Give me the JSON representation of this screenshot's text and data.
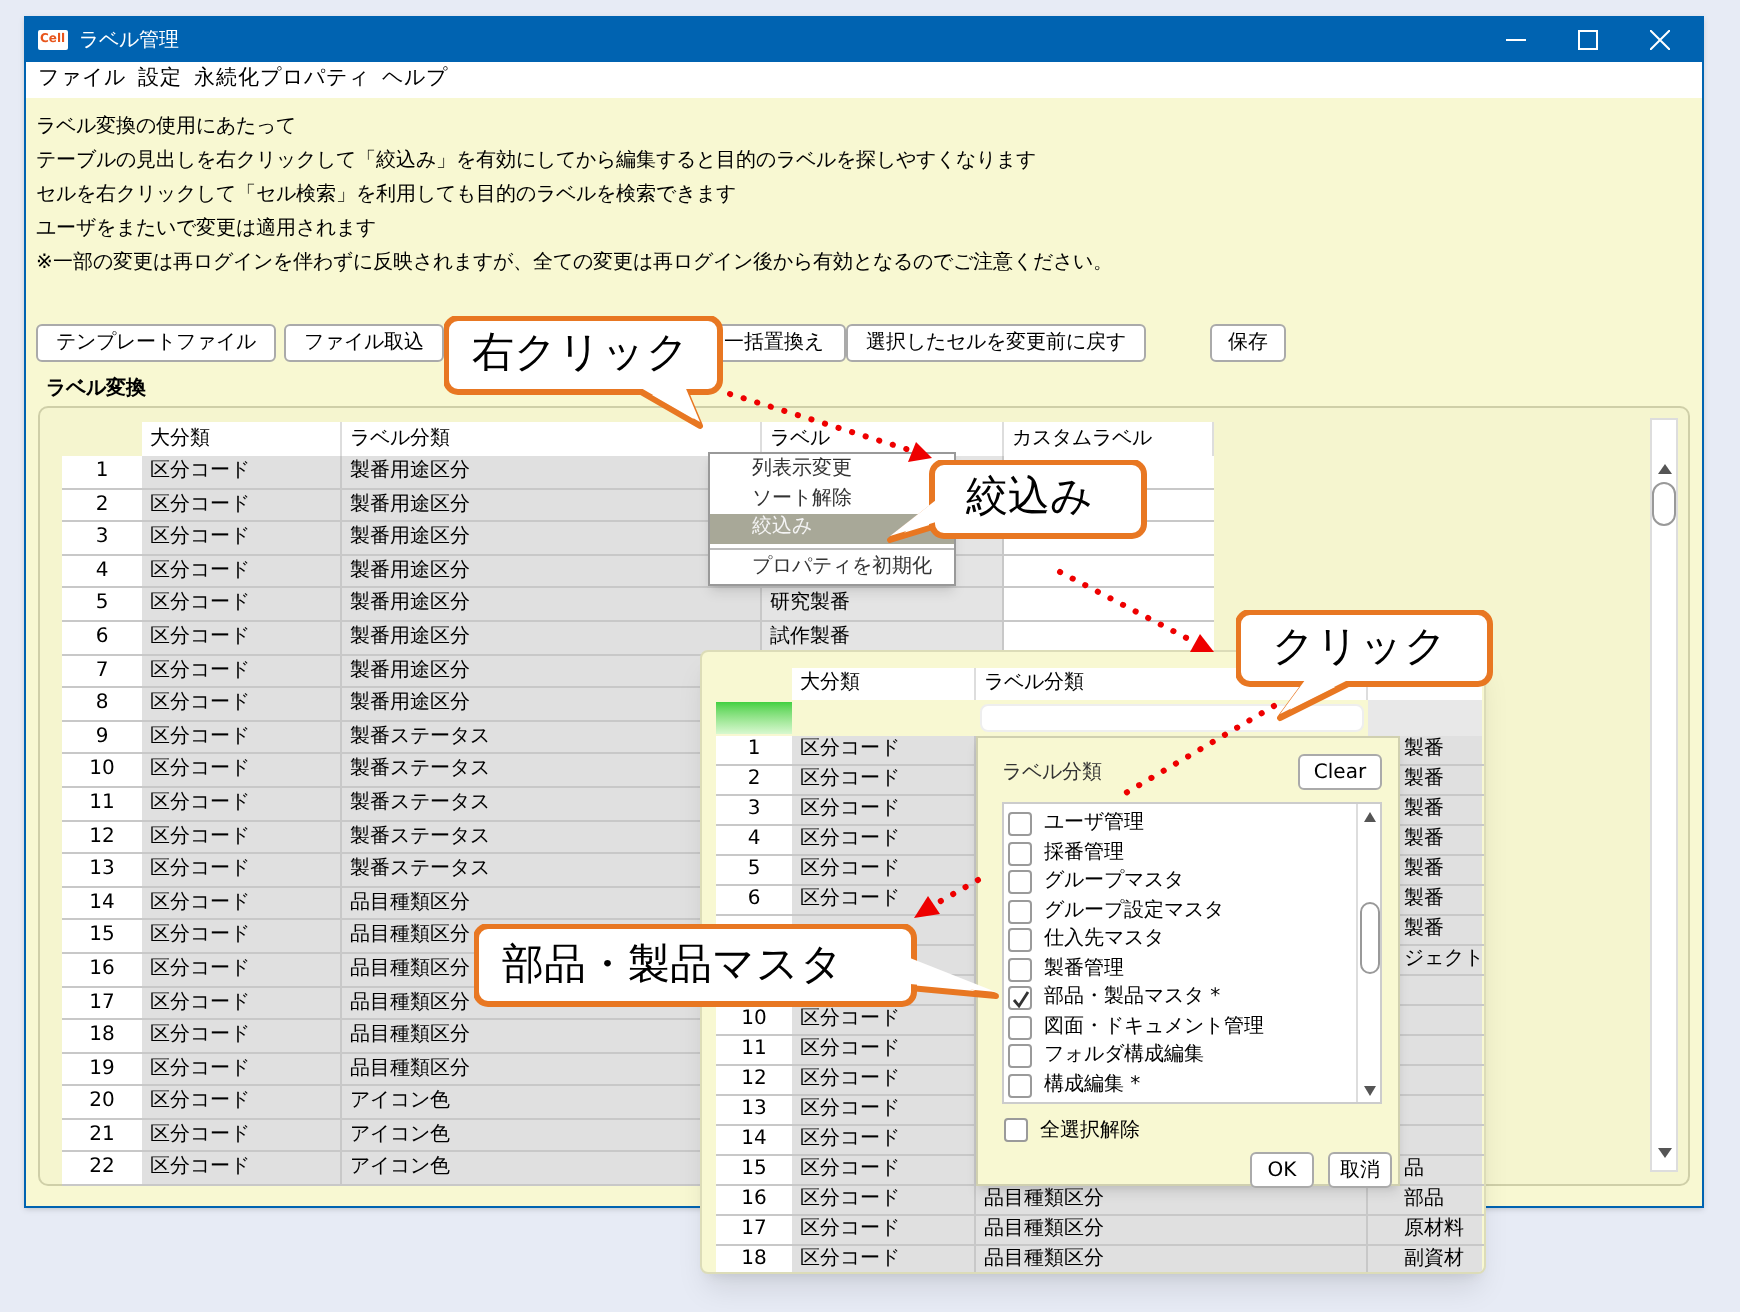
{
  "window": {
    "title": "ラベル管理",
    "badge": "Cell"
  },
  "menu": [
    "ファイル",
    "設定",
    "永続化プロパティ",
    "ヘルプ"
  ],
  "notes": [
    "ラベル変換の使用にあたって",
    "テーブルの見出しを右クリックして「絞込み」を有効にしてから編集すると目的のラベルを探しやすくなります",
    "セルを右クリックして「セル検索」を利用しても目的のラベルを検索できます",
    "ユーザをまたいで変更は適用されます",
    "※一部の変更は再ログインを伴わずに反映されますが、全ての変更は再ログイン後から有効となるのでご注意ください。"
  ],
  "toolbar": [
    "テンプレートファイル",
    "ファイル取込",
    "一括置換え",
    "選択したセルを変更前に戻す",
    "保存"
  ],
  "section_title": "ラベル変換",
  "table": {
    "columns": [
      "大分類",
      "ラベル分類",
      "ラベル",
      "カスタムラベル"
    ],
    "rows": [
      {
        "number": "1",
        "category": "区分コード",
        "label_class": "製番用途区分"
      },
      {
        "number": "2",
        "category": "区分コード",
        "label_class": "製番用途区分"
      },
      {
        "number": "3",
        "category": "区分コード",
        "label_class": "製番用途区分"
      },
      {
        "number": "4",
        "category": "区分コード",
        "label_class": "製番用途区分"
      },
      {
        "number": "5",
        "category": "区分コード",
        "label_class": "製番用途区分",
        "label": "研究製番"
      },
      {
        "number": "6",
        "category": "区分コード",
        "label_class": "製番用途区分",
        "label": "試作製番"
      },
      {
        "number": "7",
        "category": "区分コード",
        "label_class": "製番用途区分"
      },
      {
        "number": "8",
        "category": "区分コード",
        "label_class": "製番用途区分"
      },
      {
        "number": "9",
        "category": "区分コード",
        "label_class": "製番ステータス"
      },
      {
        "number": "10",
        "category": "区分コード",
        "label_class": "製番ステータス"
      },
      {
        "number": "11",
        "category": "区分コード",
        "label_class": "製番ステータス"
      },
      {
        "number": "12",
        "category": "区分コード",
        "label_class": "製番ステータス"
      },
      {
        "number": "13",
        "category": "区分コード",
        "label_class": "製番ステータス"
      },
      {
        "number": "14",
        "category": "区分コード",
        "label_class": "品目種類区分"
      },
      {
        "number": "15",
        "category": "区分コード",
        "label_class": "品目種類区分"
      },
      {
        "number": "16",
        "category": "区分コード",
        "label_class": "品目種類区分"
      },
      {
        "number": "17",
        "category": "区分コード",
        "label_class": "品目種類区分"
      },
      {
        "number": "18",
        "category": "区分コード",
        "label_class": "品目種類区分"
      },
      {
        "number": "19",
        "category": "区分コード",
        "label_class": "品目種類区分"
      },
      {
        "number": "20",
        "category": "区分コード",
        "label_class": "アイコン色"
      },
      {
        "number": "21",
        "category": "区分コード",
        "label_class": "アイコン色"
      },
      {
        "number": "22",
        "category": "区分コード",
        "label_class": "アイコン色"
      }
    ]
  },
  "context_menu": {
    "items": [
      {
        "kind": "item",
        "label": "列表示変更",
        "selected": false
      },
      {
        "kind": "item",
        "label": "ソート解除",
        "selected": false
      },
      {
        "kind": "item",
        "label": "絞込み",
        "selected": true
      },
      {
        "kind": "separator"
      },
      {
        "kind": "item",
        "label": "プロパティを初期化",
        "selected": false
      }
    ]
  },
  "filter_window": {
    "columns": [
      "大分類",
      "ラベル分類"
    ],
    "rows": [
      {
        "number": "1",
        "category": "区分コード",
        "column_3": "製番"
      },
      {
        "number": "2",
        "category": "区分コード",
        "column_3": "製番"
      },
      {
        "number": "3",
        "category": "区分コード",
        "column_3": "製番"
      },
      {
        "number": "4",
        "category": "区分コード",
        "column_3": "製番"
      },
      {
        "number": "5",
        "category": "区分コード",
        "column_3": "製番"
      },
      {
        "number": "6",
        "category": "区分コード",
        "column_3": "製番"
      },
      {
        "column_3": "製番"
      },
      {
        "column_3": "ジェクト"
      },
      {},
      {
        "number": "10",
        "category": "区分コード"
      },
      {
        "number": "11",
        "category": "区分コード"
      },
      {
        "number": "12",
        "category": "区分コード"
      },
      {
        "number": "13",
        "category": "区分コード"
      },
      {
        "number": "14",
        "category": "区分コード"
      },
      {
        "number": "15",
        "category": "区分コード",
        "column_3": "品"
      },
      {
        "number": "16",
        "category": "区分コード",
        "label_class": "品目種類区分",
        "column_3": "部品"
      },
      {
        "number": "17",
        "category": "区分コード",
        "label_class": "品目種類区分",
        "column_3": "原材料"
      },
      {
        "number": "18",
        "category": "区分コード",
        "label_class": "品目種類区分",
        "column_3": "副資材"
      }
    ],
    "filter_popup": {
      "title": "ラベル分類",
      "clear_button": "Clear",
      "options": [
        {
          "label": "ユーザ管理",
          "checked": false
        },
        {
          "label": "採番管理",
          "checked": false
        },
        {
          "label": "グループマスタ",
          "checked": false
        },
        {
          "label": "グループ設定マスタ",
          "checked": false
        },
        {
          "label": "仕入先マスタ",
          "checked": false
        },
        {
          "label": "製番管理",
          "checked": false
        },
        {
          "label": "部品・製品マスタ *",
          "checked": true
        },
        {
          "label": "図面・ドキュメント管理",
          "checked": false
        },
        {
          "label": "フォルダ構成編集",
          "checked": false
        },
        {
          "label": "構成編集 *",
          "checked": false
        }
      ],
      "clear_all": {
        "label": "全選択解除",
        "checked": false
      },
      "buttons": [
        "OK",
        "取消"
      ]
    }
  },
  "callouts": [
    "右クリック",
    "絞込み",
    "クリック",
    "部品・製品マスタ"
  ]
}
